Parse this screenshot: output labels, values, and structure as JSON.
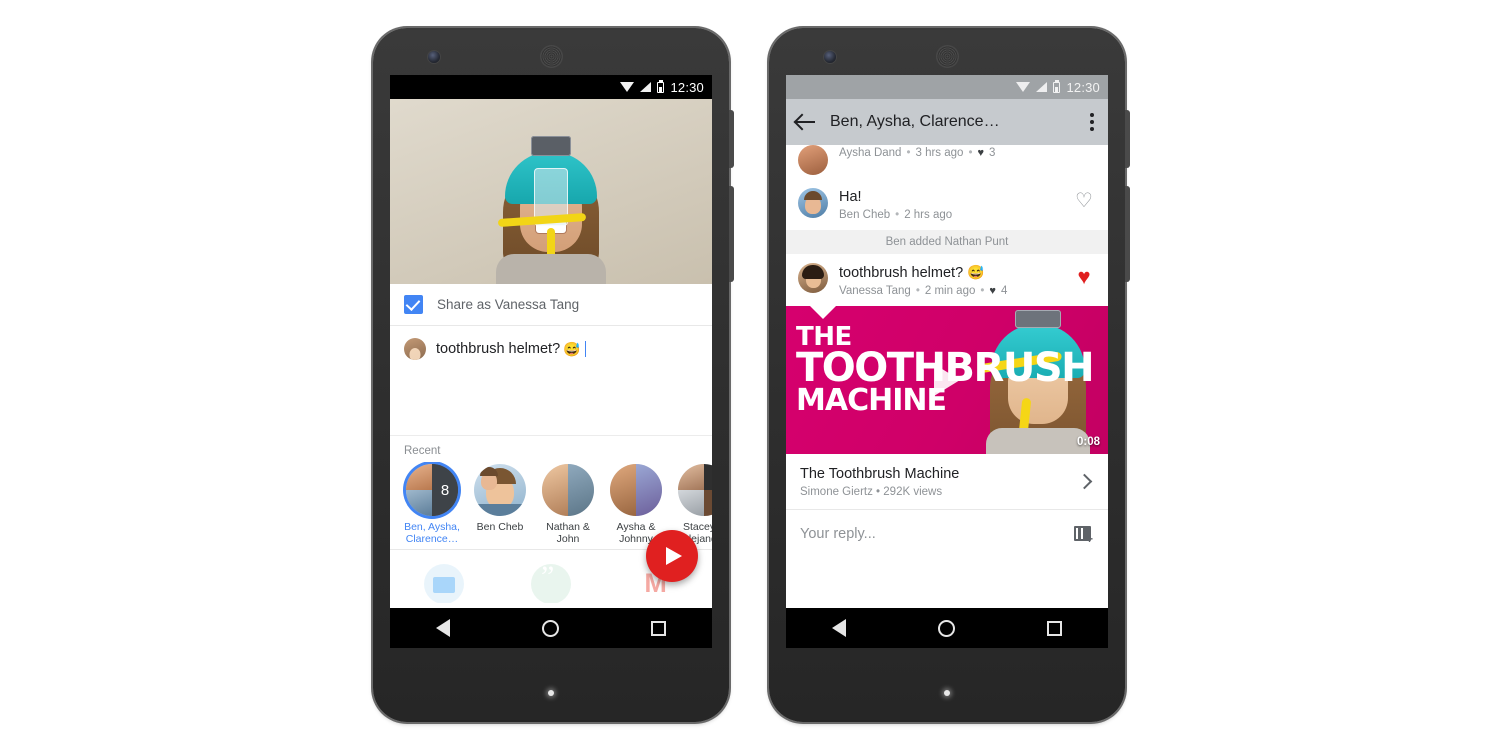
{
  "left_phone": {
    "status_bar": {
      "time": "12:30",
      "icons": [
        "wifi-icon",
        "signal-icon",
        "battery-icon"
      ]
    },
    "photo_preview": {
      "alt": "woman wearing toothbrush helmet"
    },
    "share_as": {
      "label": "Share as Vanessa Tang",
      "checked": true,
      "checkbox_color": "#4285f4"
    },
    "compose": {
      "text": "toothbrush helmet?",
      "emoji": "😅",
      "author_avatar": "vanessa-avatar"
    },
    "recent": {
      "title": "Recent",
      "contacts": [
        {
          "name": "Ben, Aysha, Clarence…",
          "badge": "8",
          "selected": true
        },
        {
          "name": "Ben Cheb",
          "badge": "",
          "selected": false
        },
        {
          "name": "Nathan & John",
          "badge": "",
          "selected": false
        },
        {
          "name": "Aysha & Johnny",
          "badge": "",
          "selected": false
        },
        {
          "name": "Stacey & Alejandro",
          "badge": "",
          "selected": false
        }
      ]
    },
    "send_button": {
      "name": "send-fab",
      "color": "#e02020"
    },
    "share_apps": [
      "messages-icon",
      "hangouts-icon",
      "gmail-icon"
    ],
    "nav_bar": [
      "back-button",
      "home-button",
      "recents-button"
    ]
  },
  "right_phone": {
    "status_bar": {
      "time": "12:30",
      "icons": [
        "wifi-icon",
        "signal-icon",
        "battery-icon"
      ]
    },
    "app_bar": {
      "title": "Ben, Aysha, Clarence…",
      "back": "back-arrow",
      "overflow": "more-options"
    },
    "messages": [
      {
        "text": "",
        "author": "Aysha Dand",
        "time": "3 hrs ago",
        "likes": "3",
        "liked": false,
        "clipped": true
      },
      {
        "text": "Ha!",
        "author": "Ben Cheb",
        "time": "2 hrs ago",
        "likes": "",
        "liked": false,
        "clipped": false
      }
    ],
    "system_event": "Ben added Nathan Punt",
    "highlight_message": {
      "text": "toothbrush helmet?",
      "emoji": "😅",
      "author": "Vanessa Tang",
      "time": "2 min ago",
      "likes": "4",
      "liked": true
    },
    "video_card": {
      "overlay_title_line1": "THE",
      "overlay_title_line2": "TOOTHBRUSH",
      "overlay_title_line3": "MACHINE",
      "duration": "0:08",
      "bg_color": "#d6006e",
      "title": "The Toothbrush Machine",
      "subtitle": "Simone Giertz • 292K views"
    },
    "reply": {
      "placeholder": "Your reply...",
      "attach_icon": "film-add-icon"
    },
    "nav_bar": [
      "back-button",
      "home-button",
      "recents-button"
    ]
  }
}
